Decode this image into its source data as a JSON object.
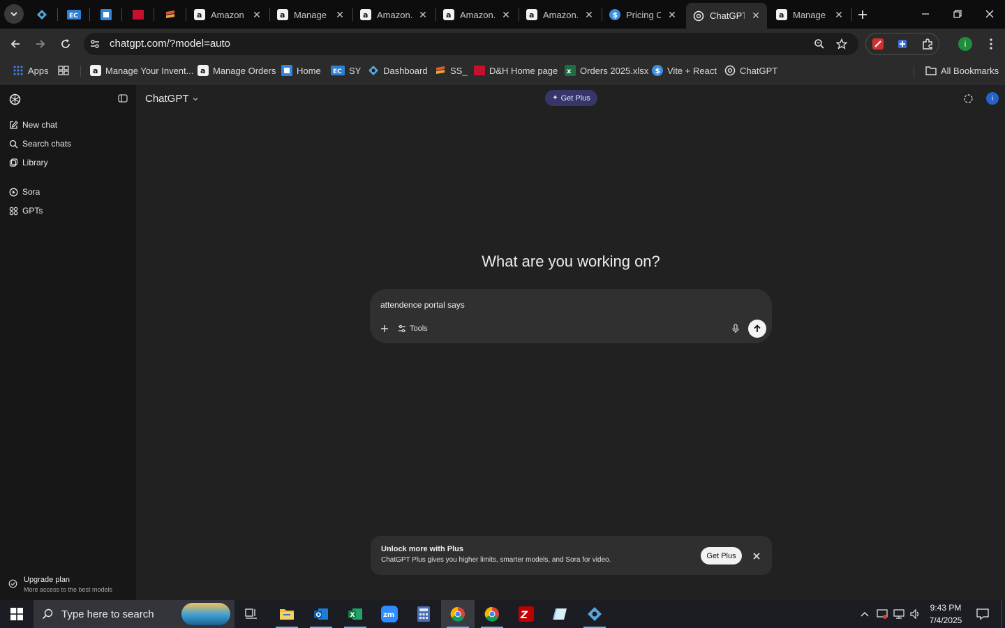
{
  "browser": {
    "tabs": [
      {
        "title": "Amazon",
        "icon": "amazon-favicon"
      },
      {
        "title": "Manage",
        "icon": "amazon-favicon"
      },
      {
        "title": "Amazon.",
        "icon": "amazon-favicon"
      },
      {
        "title": "Amazon.",
        "icon": "amazon-favicon"
      },
      {
        "title": "Amazon.",
        "icon": "amazon-favicon"
      },
      {
        "title": "Pricing C",
        "icon": "dollar-favicon"
      },
      {
        "title": "ChatGPT",
        "icon": "openai-favicon"
      },
      {
        "title": "Manage",
        "icon": "amazon-favicon"
      }
    ],
    "url": "chatgpt.com/?model=auto",
    "bookmarks": [
      {
        "label": "Apps",
        "icon": "apps-grid-icon"
      },
      {
        "label": "Manage Your Invent...",
        "icon": "amazon-favicon"
      },
      {
        "label": "Manage Orders",
        "icon": "amazon-favicon"
      },
      {
        "label": "Home",
        "icon": "home-favicon"
      },
      {
        "label": "SY",
        "icon": "ec-favicon"
      },
      {
        "label": "Dashboard",
        "icon": "diamond-favicon"
      },
      {
        "label": "SS_",
        "icon": "ss-favicon"
      },
      {
        "label": "D&H Home page",
        "icon": "dh-favicon"
      },
      {
        "label": "Orders 2025.xlsx",
        "icon": "excel-favicon"
      },
      {
        "label": "Vite + React",
        "icon": "dollar-favicon"
      },
      {
        "label": "ChatGPT",
        "icon": "openai-favicon"
      }
    ],
    "all_bookmarks_label": "All Bookmarks",
    "profile_initial": "i"
  },
  "sidebar": {
    "items": [
      {
        "label": "New chat",
        "icon": "edit-icon"
      },
      {
        "label": "Search chats",
        "icon": "search-icon"
      },
      {
        "label": "Library",
        "icon": "library-icon"
      },
      {
        "label": "Sora",
        "icon": "sora-icon"
      },
      {
        "label": "GPTs",
        "icon": "grid-icon"
      }
    ],
    "upgrade": {
      "title": "Upgrade plan",
      "subtitle": "More access to the best models"
    }
  },
  "main": {
    "model_selector": "ChatGPT",
    "get_plus_label": "Get Plus",
    "headline": "What are you working on?",
    "composer": {
      "text": "attendence portal says",
      "tools_label": "Tools"
    },
    "banner": {
      "title": "Unlock more with Plus",
      "subtitle": "ChatGPT Plus gives you higher limits, smarter models, and Sora for video.",
      "button_label": "Get Plus"
    },
    "user_avatar_initial": "i"
  },
  "taskbar": {
    "search_placeholder": "Type here to search",
    "time": "9:43 PM",
    "date": "7/4/2025"
  },
  "colors": {
    "chat_bg": "#212121",
    "sidebar_bg": "#171717",
    "composer_bg": "#303030",
    "plus_badge": "#373669",
    "taskbar_bg": "#1c1d22"
  }
}
